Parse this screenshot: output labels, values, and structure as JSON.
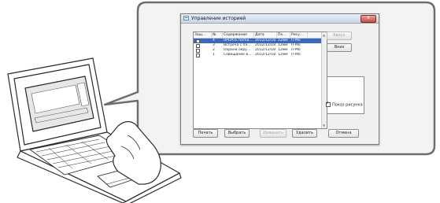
{
  "window": {
    "title": "Управление историей",
    "close_glyph": "x"
  },
  "table": {
    "columns": [
      "Защ...",
      "№",
      "Содержание",
      "Дата",
      "Пе...",
      "Рису..."
    ],
    "rows": [
      {
        "no": "4",
        "content": "UPDATE forma...",
        "date": "2012/12/18",
        "period": "12мм",
        "pic": "П-Мо",
        "selected": true
      },
      {
        "no": "3",
        "content": "Встреча с па...",
        "date": "2012/12/18",
        "period": "12мм",
        "pic": "П-Мо",
        "selected": false
      },
      {
        "no": "2",
        "content": "Охрана окру...",
        "date": "2012/12/18",
        "period": "12мм",
        "pic": "П-Мо",
        "selected": false
      },
      {
        "no": "1",
        "content": "Совещание в...",
        "date": "2012/12/18",
        "period": "12мм",
        "pic": "П-Мо",
        "selected": false
      }
    ]
  },
  "buttons": {
    "up": "Вверх",
    "down": "Вниз",
    "print": "Печать",
    "select": "Выбрать",
    "modify": "Изменить",
    "delete": "Удалить",
    "cancel": "Отмена"
  },
  "options": {
    "show_picture": "Показ рисунка"
  },
  "colors": {
    "selection": "#3569c4",
    "bubble_border": "#6e6e6e",
    "bubble_fill": "#f3f3f3"
  }
}
